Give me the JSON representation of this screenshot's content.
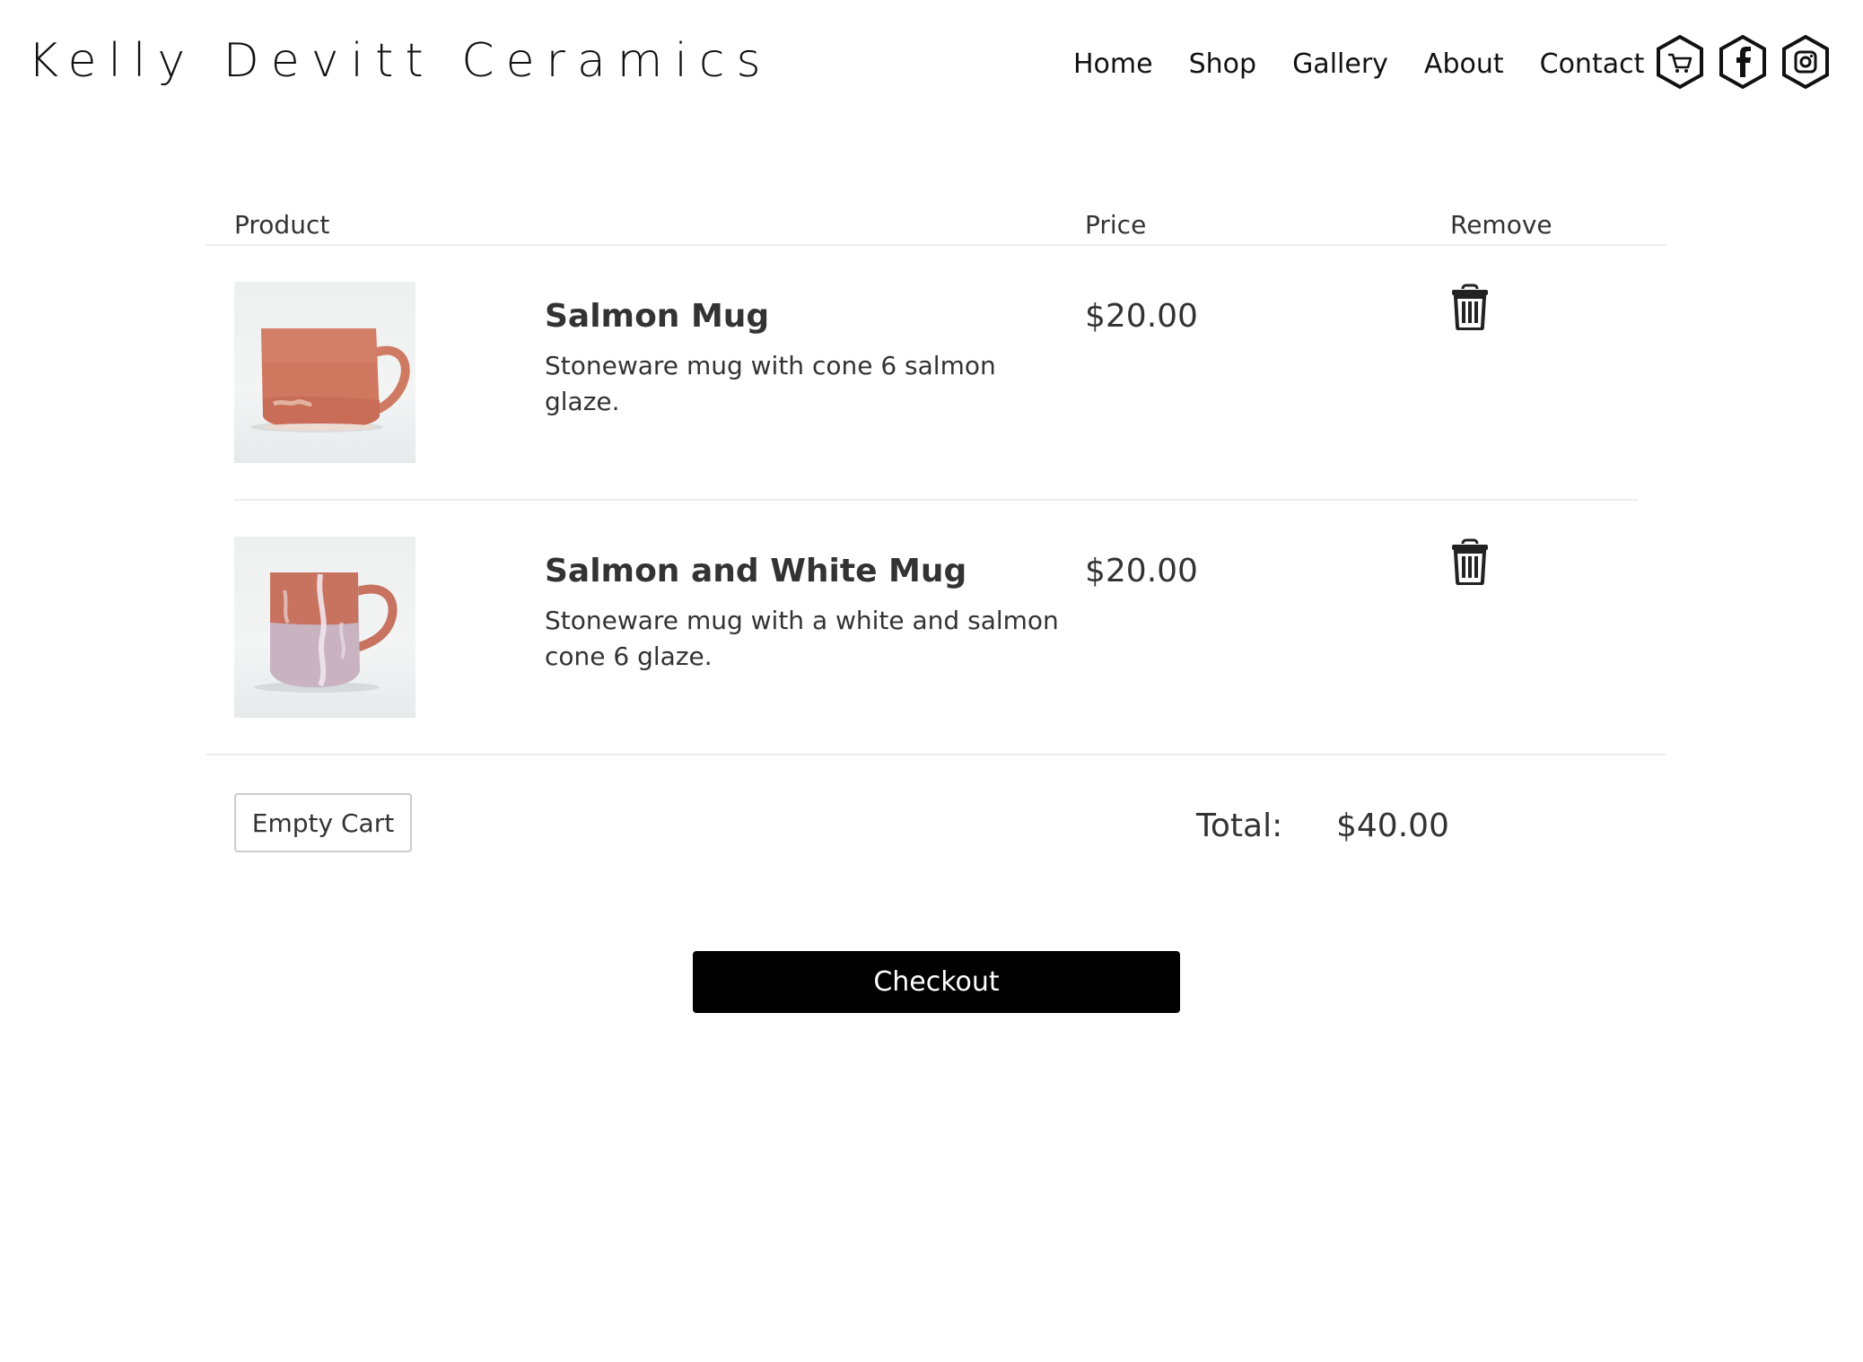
{
  "site": {
    "brand": "Kelly Devitt Ceramics"
  },
  "nav": {
    "items": [
      "Home",
      "Shop",
      "Gallery",
      "About",
      "Contact"
    ]
  },
  "header_icons": [
    "cart-icon",
    "facebook-icon",
    "instagram-icon"
  ],
  "cart": {
    "headers": {
      "product": "Product",
      "price": "Price",
      "remove": "Remove"
    },
    "items": [
      {
        "name": "Salmon Mug",
        "description": "Stoneware mug with cone 6 salmon glaze.",
        "price": "$20.00",
        "image_icon": "salmon-mug-image"
      },
      {
        "name": "Salmon and White Mug",
        "description": "Stoneware mug with a white and salmon cone 6 glaze.",
        "price": "$20.00",
        "image_icon": "salmon-white-mug-image"
      }
    ],
    "empty_label": "Empty Cart",
    "total_label": "Total:",
    "total_value": "$40.00",
    "checkout_label": "Checkout"
  },
  "colors": {
    "text": "#222222",
    "button_primary": "#000000",
    "divider": "#ececec",
    "salmon_glaze": "#d0775f",
    "white_glaze": "#c9b3c1"
  }
}
